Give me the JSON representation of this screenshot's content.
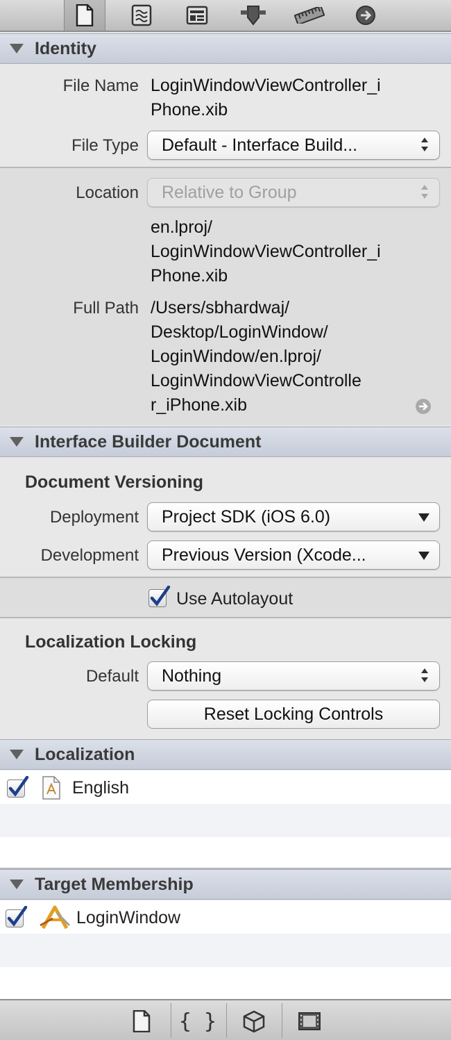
{
  "toolbar": {
    "icons": [
      "file-inspector-icon",
      "quick-help-icon",
      "identity-inspector-icon",
      "attributes-inspector-icon",
      "size-inspector-icon",
      "connections-inspector-icon"
    ]
  },
  "identity": {
    "header": "Identity",
    "file_name_label": "File Name",
    "file_name_line1": "LoginWindowViewController_i",
    "file_name_line2": "Phone.xib",
    "file_type_label": "File Type",
    "file_type_value": "Default - Interface Build...",
    "location_label": "Location",
    "location_value": "Relative to Group",
    "location_path_line1": "en.lproj/",
    "location_path_line2": "LoginWindowViewController_i",
    "location_path_line3": "Phone.xib",
    "full_path_label": "Full Path",
    "full_path_line1": "/Users/sbhardwaj/",
    "full_path_line2": "Desktop/LoginWindow/",
    "full_path_line3": "LoginWindow/en.lproj/",
    "full_path_line4": "LoginWindowViewControlle",
    "full_path_line5": "r_iPhone.xib"
  },
  "ib_document": {
    "header": "Interface Builder Document",
    "versioning_title": "Document Versioning",
    "deployment_label": "Deployment",
    "deployment_value": "Project SDK (iOS 6.0)",
    "development_label": "Development",
    "development_value": "Previous Version (Xcode...",
    "autolayout_label": "Use Autolayout",
    "locking_title": "Localization Locking",
    "default_label": "Default",
    "default_value": "Nothing",
    "reset_button": "Reset Locking Controls"
  },
  "localization": {
    "header": "Localization",
    "items": [
      {
        "label": "English",
        "checked": true
      }
    ]
  },
  "target_membership": {
    "header": "Target Membership",
    "items": [
      {
        "label": "LoginWindow",
        "checked": true
      }
    ]
  },
  "bottom_bar": {
    "icons": [
      "file-template-icon",
      "code-snippet-icon",
      "object-library-icon",
      "media-library-icon"
    ]
  }
}
